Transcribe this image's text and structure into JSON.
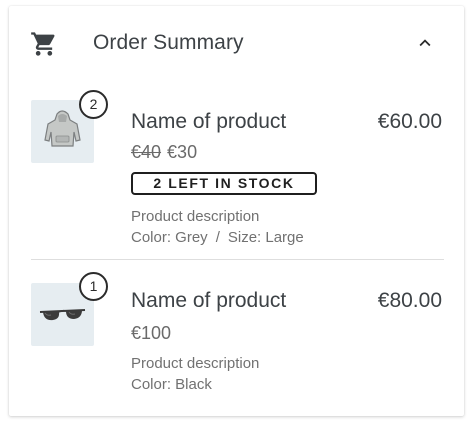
{
  "header": {
    "title": "Order Summary",
    "cart_icon": "shopping-cart-icon",
    "toggle_icon": "chevron-up-icon"
  },
  "items": [
    {
      "quantity": "2",
      "image": "hoodie",
      "name": "Name of product",
      "line_price": "€60.00",
      "original_price": "€40",
      "sale_price": "€30",
      "stock_badge": "2 LEFT IN STOCK",
      "description": "Product description",
      "color": "Color: Grey",
      "separator": "/",
      "size": "Size: Large"
    },
    {
      "quantity": "1",
      "image": "sunglasses",
      "name": "Name of product",
      "line_price": "€80.00",
      "unit_price": "€100",
      "description": "Product description",
      "color": "Color: Black"
    }
  ],
  "colors": {
    "text": "#3d4246",
    "muted": "#717171",
    "thumb_bg": "#e6edf1",
    "divider": "#dedede"
  }
}
